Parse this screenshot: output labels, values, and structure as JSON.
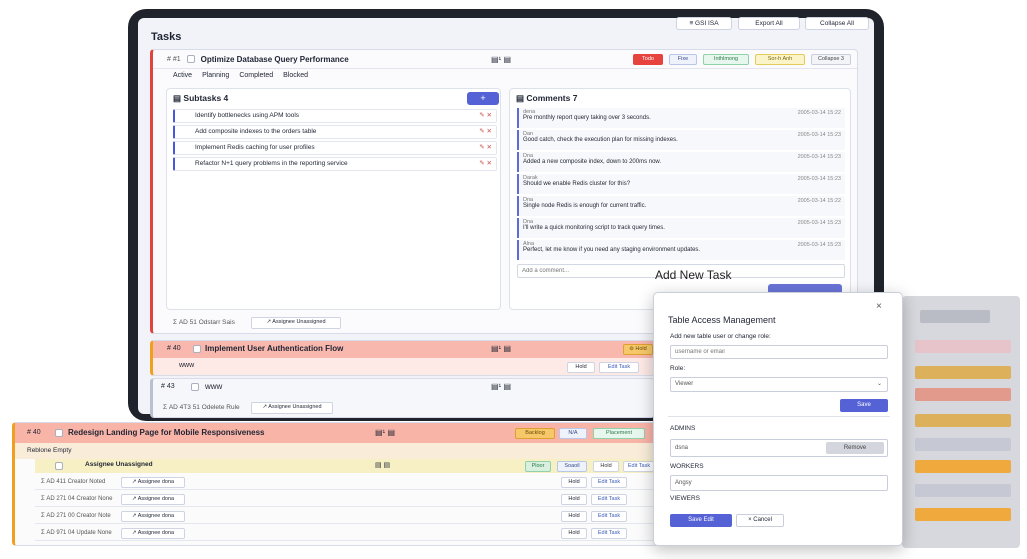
{
  "header": {
    "btn1": "≡ GSI ISA",
    "btn2": "Export All",
    "btn3": "Collapse All"
  },
  "app_title": "Tasks",
  "task1": {
    "id": "# #1",
    "title": "Optimize Database Query Performance",
    "badges": [
      "Todo",
      "Fixe",
      "Inthlmong",
      "Sor-h Anh",
      "Collapse 3"
    ],
    "filters": [
      "Active",
      "Planning",
      "Completed",
      "Blocked"
    ],
    "subtasks_title": "Subtasks 4",
    "add": "+",
    "subtasks": [
      "Identify bottlenecks using APM tools",
      "Add composite indexes to the orders table",
      "Implement Redis caching for user profiles",
      "Refactor N+1 query problems in the reporting service"
    ],
    "comments_title": "Comments 7",
    "comments": [
      {
        "a": "dena",
        "t": "Pre monthly report query taking over 3 seconds.",
        "d": "2005-03-14 15:22"
      },
      {
        "a": "Dan",
        "t": "Good catch, check the execution plan for missing indexes.",
        "d": "2005-03-14 15:23"
      },
      {
        "a": "Dna",
        "t": "Added a new composite index, down to 200ms now.",
        "d": "2005-03-14 15:23"
      },
      {
        "a": "Darak",
        "t": "Should we enable Redis cluster for this?",
        "d": "2005-03-14 15:23"
      },
      {
        "a": "Dna",
        "t": "Single node Redis is enough for current traffic.",
        "d": "2005-03-14 15:22"
      },
      {
        "a": "Dna",
        "t": "I'll write a quick monitoring script to track query times.",
        "d": "2005-03-14 15:23"
      },
      {
        "a": "Alna",
        "t": "Perfect, let me know if you need any staging environment updates.",
        "d": "2005-03-14 15:23"
      }
    ],
    "comment_placeholder": "Add a comment...",
    "footer_meta": "Σ AD 51 Odstarr Sais",
    "footer_assignee": "↗ Assignee Unassigned"
  },
  "task2": {
    "id": "# 40",
    "title": "Implement User Authentication Flow",
    "sub": "www",
    "btn_hold": "Hold",
    "btn_edit": "Edit Task",
    "badge": "⊚ Hold"
  },
  "task3": {
    "id": "# 43",
    "title": "www",
    "meta": "Σ AD 4T3 51 Odelete Rule",
    "assignee": "↗ Assignee Unassigned"
  },
  "task4": {
    "id": "# 40",
    "title": "Redesign Landing Page for Mobile Responsiveness",
    "badges": [
      "Backlog",
      "N/A",
      "Placement"
    ],
    "sub": "Reblone Empty",
    "child": "Assignee Unassigned",
    "child_badges": [
      "Ploor",
      "Soaoil",
      "Hold",
      "Edit Task"
    ],
    "rows": [
      {
        "m": "Σ AD 411 Creator Noted",
        "a": "↗ Assignee dona",
        "h": "Hold",
        "e": "Edit Task"
      },
      {
        "m": "Σ AD 271 04 Creator None",
        "a": "↗ Assignee dona",
        "h": "Hold",
        "e": "Edit Task"
      },
      {
        "m": "Σ AD 271 00 Creator Note",
        "a": "↗ Assignee dona",
        "h": "Hold",
        "e": "Edit Task"
      },
      {
        "m": "Σ AD 971 04 Update None",
        "a": "↗ Assignee dona",
        "h": "Hold",
        "e": "Edit Task"
      }
    ]
  },
  "add_new_task": "Add New Task",
  "modal": {
    "title": "Table Access Management",
    "close": "×",
    "add_label": "Add new table user or change role:",
    "input_placeholder": "username or email",
    "role_label": "Role:",
    "role_value": "Viewer",
    "save": "Save",
    "admins": "ADMINS",
    "admin_user": "dsna",
    "remove": "Remove",
    "workers": "WORKERS",
    "worker_user": "Angsy",
    "viewers": "VIEWERS",
    "confirm": "Save Edit",
    "cancel": "× Cancel"
  }
}
